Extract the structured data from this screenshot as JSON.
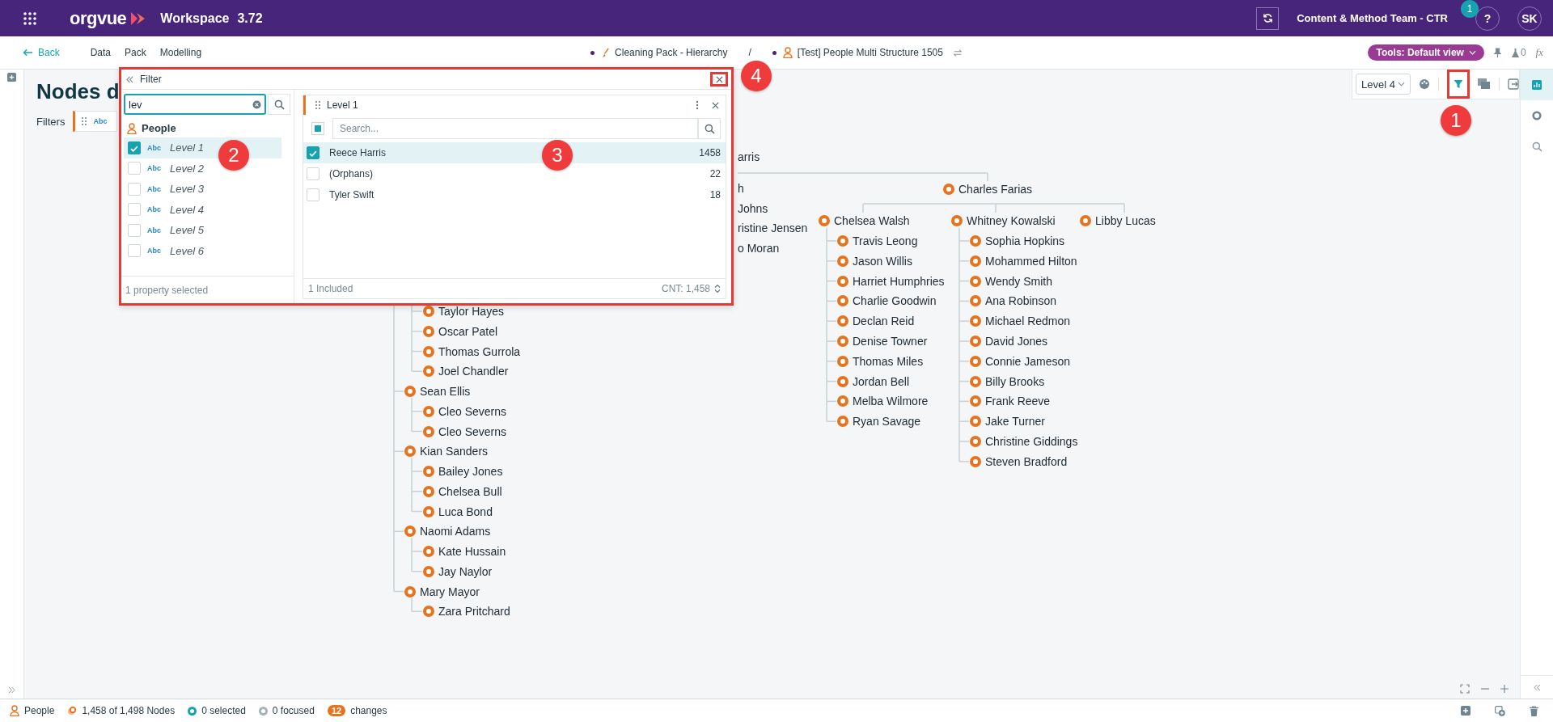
{
  "app_bar": {
    "logo": "orgvue",
    "product": "Workspace",
    "version": "3.72",
    "team": "Content & Method Team - CTR",
    "notification_count": "1",
    "help": "?",
    "user_initials": "SK"
  },
  "nav_bar": {
    "back": "Back",
    "menu": [
      "Data",
      "Pack",
      "Modelling"
    ],
    "breadcrumbs": [
      {
        "label": "Cleaning Pack - Hierarchy",
        "kind": "pack"
      },
      {
        "label": "[Test] People Multi Structure 1505",
        "kind": "dataset"
      }
    ],
    "separator": "/",
    "tools_button": "Tools: Default view",
    "flask_count": "0",
    "formula": "fx"
  },
  "page": {
    "title": "Nodes d",
    "filters_label": "Filters",
    "filter_chip": "Abc"
  },
  "toolbar": {
    "level_select": "Level 4"
  },
  "filter_panel": {
    "title": "Filter",
    "search_value": "lev",
    "group": "People",
    "properties": [
      {
        "tag": "Abc",
        "label": "Level 1",
        "checked": true,
        "selected": true
      },
      {
        "tag": "Abc",
        "label": "Level 2",
        "checked": false,
        "selected": false
      },
      {
        "tag": "Abc",
        "label": "Level 3",
        "checked": false,
        "selected": false
      },
      {
        "tag": "Abc",
        "label": "Level 4",
        "checked": false,
        "selected": false
      },
      {
        "tag": "Abc",
        "label": "Level 5",
        "checked": false,
        "selected": false
      },
      {
        "tag": "Abc",
        "label": "Level 6",
        "checked": false,
        "selected": false
      }
    ],
    "footer": "1 property selected",
    "values_card": {
      "title": "Level 1",
      "select_all": {
        "checked": false,
        "indeterminate": true
      },
      "search_placeholder": "Search...",
      "values": [
        {
          "label": "Reece Harris",
          "count": "1458",
          "checked": true,
          "selected": true
        },
        {
          "label": "(Orphans)",
          "count": "22",
          "checked": false,
          "selected": false
        },
        {
          "label": "Tyler Swift",
          "count": "18",
          "checked": false,
          "selected": false
        }
      ],
      "included": "1 Included",
      "total": "CNT: 1,458"
    }
  },
  "annotations": [
    "1",
    "2",
    "3",
    "4"
  ],
  "tree": {
    "root_fragment": "arris",
    "hidden_fragments": [
      "h",
      "Johns",
      "ristine Jensen",
      "o Moran"
    ],
    "left_branch": [
      {
        "children": [
          {
            "name": "Taylor Hayes"
          },
          {
            "name": "Oscar Patel"
          },
          {
            "name": "Thomas Gurrola"
          },
          {
            "name": "Joel Chandler"
          }
        ]
      },
      {
        "name": "Sean Ellis",
        "children": [
          {
            "name": "Cleo Severns"
          },
          {
            "name": "Cleo Severns"
          }
        ]
      },
      {
        "name": "Kian Sanders",
        "children": [
          {
            "name": "Bailey Jones"
          },
          {
            "name": "Chelsea Bull"
          },
          {
            "name": "Luca Bond"
          }
        ]
      },
      {
        "name": "Naomi Adams",
        "children": [
          {
            "name": "Kate Hussain"
          },
          {
            "name": "Jay Naylor"
          }
        ]
      },
      {
        "name": "Mary Mayor",
        "children": [
          {
            "name": "Zara Pritchard"
          }
        ]
      }
    ],
    "right_branch": {
      "name": "Charles Farias",
      "children": [
        {
          "name": "Chelsea Walsh",
          "children": [
            {
              "name": "Travis Leong"
            },
            {
              "name": "Jason Willis"
            },
            {
              "name": "Harriet Humphries"
            },
            {
              "name": "Charlie Goodwin"
            },
            {
              "name": "Declan Reid"
            },
            {
              "name": "Denise Towner"
            },
            {
              "name": "Thomas Miles"
            },
            {
              "name": "Jordan Bell"
            },
            {
              "name": "Melba Wilmore"
            },
            {
              "name": "Ryan Savage"
            }
          ]
        },
        {
          "name": "Whitney Kowalski",
          "children": [
            {
              "name": "Sophia Hopkins"
            },
            {
              "name": "Mohammed Hilton"
            },
            {
              "name": "Wendy Smith"
            },
            {
              "name": "Ana Robinson"
            },
            {
              "name": "Michael Redmon"
            },
            {
              "name": "David Jones"
            },
            {
              "name": "Connie Jameson"
            },
            {
              "name": "Billy Brooks"
            },
            {
              "name": "Frank Reeve"
            },
            {
              "name": "Jake Turner"
            },
            {
              "name": "Christine Giddings"
            },
            {
              "name": "Steven Bradford"
            }
          ]
        },
        {
          "name": "Libby Lucas"
        }
      ]
    }
  },
  "status_bar": {
    "dataset": "People",
    "nodes": "1,458 of 1,498 Nodes",
    "selected": "0 selected",
    "focused": "0 focused",
    "changes_count": "12",
    "changes_label": "changes"
  }
}
